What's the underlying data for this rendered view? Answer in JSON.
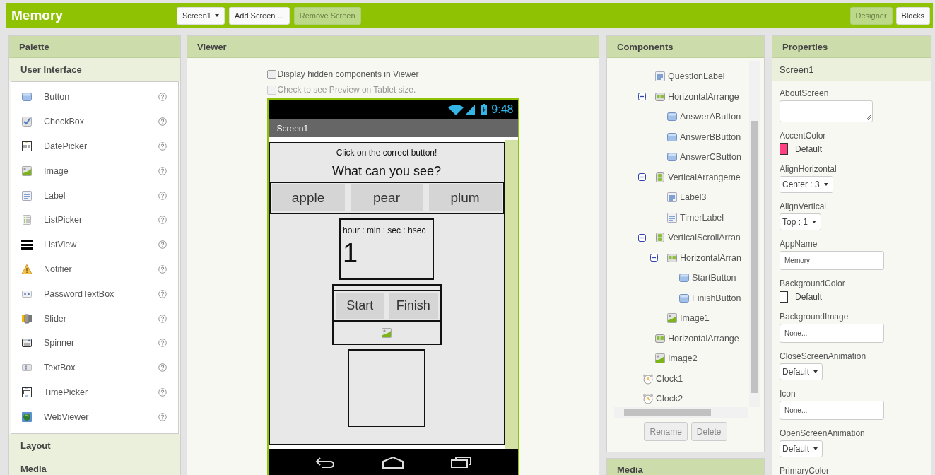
{
  "app_title": "Memory",
  "toolbar": {
    "screen_dropdown": "Screen1",
    "buttons": [
      {
        "label": "Add Screen ...",
        "disabled": false
      },
      {
        "label": "Remove Screen",
        "disabled": true
      }
    ]
  },
  "view_buttons": [
    {
      "label": "Designer",
      "selected": true
    },
    {
      "label": "Blocks",
      "selected": false
    }
  ],
  "palette": {
    "title": "Palette",
    "sections": [
      {
        "title": "User Interface",
        "expanded": true,
        "items": [
          {
            "name": "Button",
            "kind": "button"
          },
          {
            "name": "CheckBox",
            "kind": "checkbox"
          },
          {
            "name": "DatePicker",
            "kind": "datepicker"
          },
          {
            "name": "Image",
            "kind": "image"
          },
          {
            "name": "Label",
            "kind": "label"
          },
          {
            "name": "ListPicker",
            "kind": "listpicker"
          },
          {
            "name": "ListView",
            "kind": "listview"
          },
          {
            "name": "Notifier",
            "kind": "notifier"
          },
          {
            "name": "PasswordTextBox",
            "kind": "password"
          },
          {
            "name": "Slider",
            "kind": "slider"
          },
          {
            "name": "Spinner",
            "kind": "spinner"
          },
          {
            "name": "TextBox",
            "kind": "textbox"
          },
          {
            "name": "TimePicker",
            "kind": "timepicker"
          },
          {
            "name": "WebViewer",
            "kind": "webviewer"
          }
        ]
      },
      {
        "title": "Layout",
        "expanded": false
      },
      {
        "title": "Media",
        "expanded": false
      }
    ]
  },
  "viewer": {
    "title": "Viewer",
    "options": [
      {
        "label": "Display hidden components in Viewer",
        "checked": false,
        "disabled": false
      },
      {
        "label": "Check to see Preview on Tablet size.",
        "checked": false,
        "disabled": true
      }
    ],
    "phone": {
      "time": "9:48",
      "screen_title": "Screen1",
      "instruction": "Click on the correct button!",
      "question": "What can you see?",
      "answers": [
        "apple",
        "pear",
        "plum"
      ],
      "timer_caption": "hour : min : sec : hsec",
      "timer_value": "1",
      "controls": [
        "Start",
        "Finish"
      ]
    }
  },
  "components": {
    "title": "Components",
    "tree": [
      {
        "children": [
          {
            "name": "QuestionLabel",
            "kind": "label"
          },
          {
            "name": "HorizontalArrange",
            "kind": "horizontal",
            "expanded": true,
            "children": [
              {
                "name": "AnswerAButton",
                "kind": "button"
              },
              {
                "name": "AnswerBButton",
                "kind": "button"
              },
              {
                "name": "AnswerCButton",
                "kind": "button"
              }
            ]
          },
          {
            "name": "VerticalArrangeme",
            "kind": "vertical",
            "expanded": true,
            "children": [
              {
                "name": "Label3",
                "kind": "label"
              },
              {
                "name": "TimerLabel",
                "kind": "label"
              }
            ]
          },
          {
            "name": "VerticalScrollArran",
            "kind": "vertical",
            "expanded": true,
            "children": [
              {
                "name": "HorizontalArran",
                "kind": "horizontal",
                "expanded": true,
                "children": [
                  {
                    "name": "StartButton",
                    "kind": "button"
                  },
                  {
                    "name": "FinishButton",
                    "kind": "button"
                  }
                ]
              },
              {
                "name": "Image1",
                "kind": "image"
              }
            ]
          },
          {
            "name": "HorizontalArrange",
            "kind": "horizontal"
          },
          {
            "name": "Image2",
            "kind": "image"
          }
        ]
      },
      {
        "name": "Clock1",
        "kind": "clock"
      },
      {
        "name": "Clock2",
        "kind": "clock"
      }
    ],
    "buttons": [
      {
        "label": "Rename",
        "disabled": true
      },
      {
        "label": "Delete",
        "disabled": true
      }
    ],
    "next_section": "Media"
  },
  "properties": {
    "title": "Properties",
    "component": "Screen1",
    "items": [
      {
        "name": "AboutScreen",
        "kind": "textarea"
      },
      {
        "name": "AccentColor",
        "kind": "color",
        "color": "#ff4081",
        "value": "Default"
      },
      {
        "name": "AlignHorizontal",
        "kind": "dropdown",
        "value": "Center : 3"
      },
      {
        "name": "AlignVertical",
        "kind": "dropdown",
        "value": "Top : 1"
      },
      {
        "name": "AppName",
        "kind": "text",
        "value": "Memory"
      },
      {
        "name": "BackgroundColor",
        "kind": "color",
        "color": "#ffffff",
        "value": "Default"
      },
      {
        "name": "BackgroundImage",
        "kind": "text",
        "value": "None..."
      },
      {
        "name": "CloseScreenAnimation",
        "kind": "dropdown",
        "value": "Default"
      },
      {
        "name": "Icon",
        "kind": "text",
        "value": "None..."
      },
      {
        "name": "OpenScreenAnimation",
        "kind": "dropdown",
        "value": "Default"
      },
      {
        "name": "PrimaryColor",
        "kind": "label"
      }
    ]
  }
}
